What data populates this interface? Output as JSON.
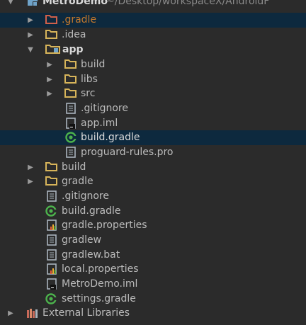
{
  "project": {
    "name": "MetroDemo",
    "path": "~/Desktop/workspaceX/AndroidF"
  },
  "items": [
    {
      "label": ".gradle"
    },
    {
      "label": ".idea"
    },
    {
      "label": "app"
    },
    {
      "label": "build"
    },
    {
      "label": "libs"
    },
    {
      "label": "src"
    },
    {
      "label": ".gitignore"
    },
    {
      "label": "app.iml"
    },
    {
      "label": "build.gradle"
    },
    {
      "label": "proguard-rules.pro"
    },
    {
      "label": "build"
    },
    {
      "label": "gradle"
    },
    {
      "label": ".gitignore"
    },
    {
      "label": "build.gradle"
    },
    {
      "label": "gradle.properties"
    },
    {
      "label": "gradlew"
    },
    {
      "label": "gradlew.bat"
    },
    {
      "label": "local.properties"
    },
    {
      "label": "MetroDemo.iml"
    },
    {
      "label": "settings.gradle"
    },
    {
      "label": "External Libraries"
    }
  ],
  "colors": {
    "background": "#2b2b2b",
    "selection": "#0d293e",
    "folder": "#d7b45a",
    "excluded_folder": "#d0604a",
    "gradle": "#4cb24c"
  }
}
